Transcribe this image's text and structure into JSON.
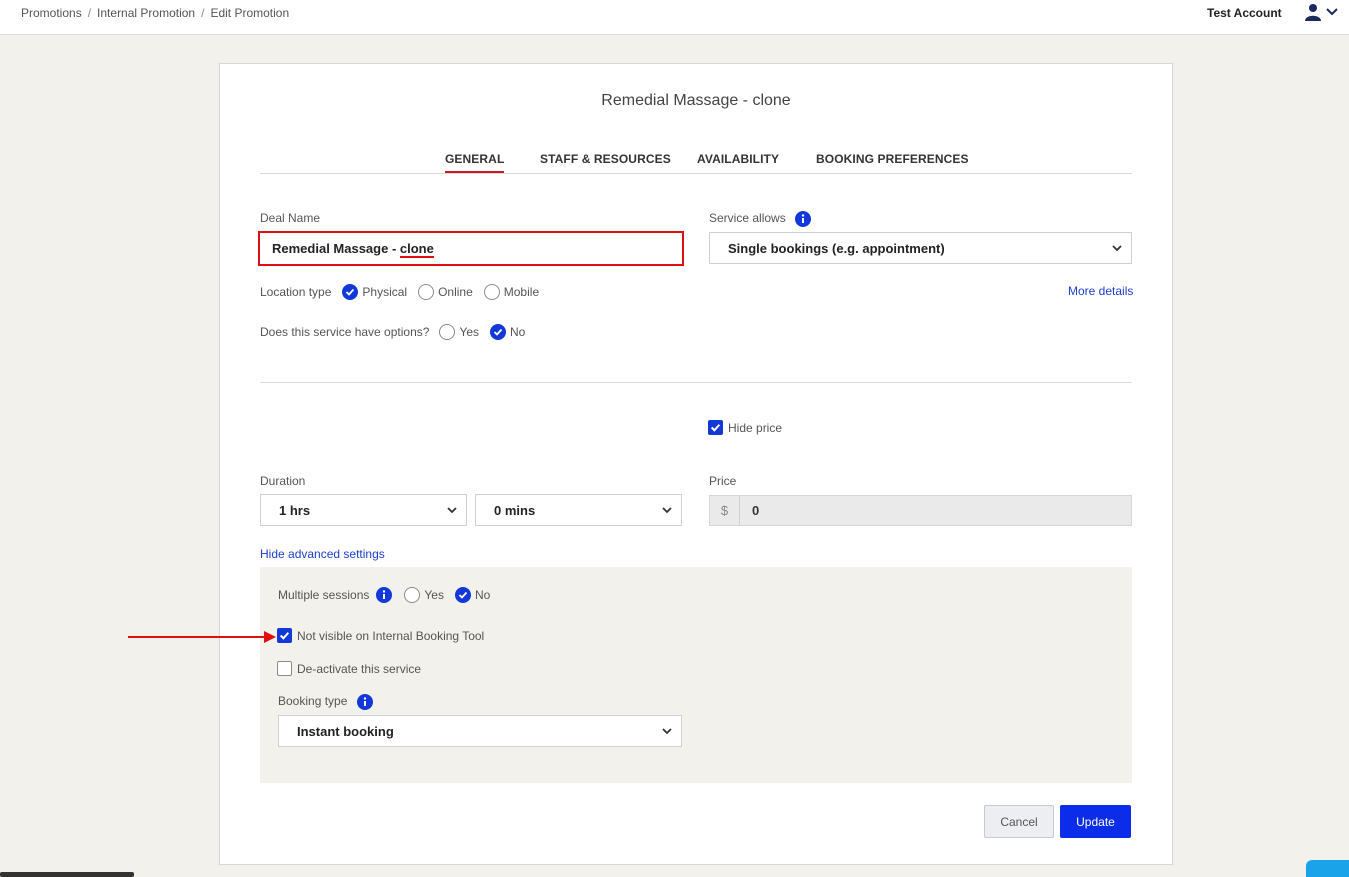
{
  "breadcrumb": {
    "items": [
      "Promotions",
      "Internal Promotion",
      "Edit Promotion"
    ],
    "separator": "/"
  },
  "account": {
    "name": "Test Account"
  },
  "card": {
    "title": "Remedial Massage - clone",
    "tabs": [
      {
        "label": "GENERAL",
        "active": true
      },
      {
        "label": "STAFF & RESOURCES"
      },
      {
        "label": "AVAILABILITY"
      },
      {
        "label": "BOOKING PREFERENCES"
      }
    ]
  },
  "general": {
    "deal_name_label": "Deal Name",
    "deal_name_prefix": "Remedial Massage - ",
    "deal_name_highlight": "clone",
    "service_allows_label": "Service allows",
    "service_allows_value": "Single bookings (e.g. appointment)",
    "location_type_label": "Location type",
    "location_options": [
      "Physical",
      "Online",
      "Mobile"
    ],
    "location_selected": "Physical",
    "more_details": "More details",
    "options_label": "Does this service have options?",
    "options_yes": "Yes",
    "options_no": "No",
    "options_selected": "No",
    "hide_price_label": "Hide price",
    "hide_price_checked": true,
    "duration_label": "Duration",
    "duration_hours": "1 hrs",
    "duration_mins": "0 mins",
    "price_label": "Price",
    "price_currency": "$",
    "price_value": "0",
    "hide_advanced": "Hide advanced settings"
  },
  "advanced": {
    "multiple_sessions_label": "Multiple sessions",
    "multiple_yes": "Yes",
    "multiple_no": "No",
    "multiple_selected": "No",
    "not_visible_label": "Not visible on Internal Booking Tool",
    "not_visible_checked": true,
    "deactivate_label": "De-activate this service",
    "deactivate_checked": false,
    "booking_type_label": "Booking type",
    "booking_type_value": "Instant booking"
  },
  "actions": {
    "cancel": "Cancel",
    "update": "Update"
  },
  "colors": {
    "accent": "#1238d9",
    "primary_button": "#0b2ce8",
    "highlight_red": "#e00e0e",
    "tab_active": "#c81c1c",
    "link": "#1d3fcf"
  }
}
